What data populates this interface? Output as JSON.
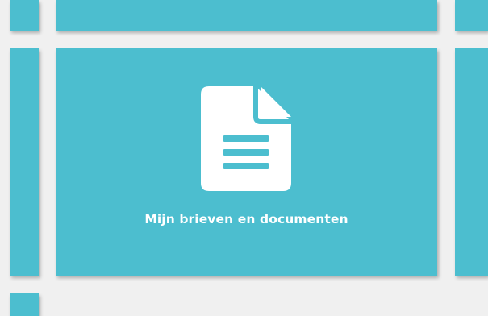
{
  "colors": {
    "background": "#f0f0f0",
    "tile": "#4cbecf",
    "icon": "#ffffff",
    "label": "#ffffff"
  },
  "main_tile": {
    "label": "Mijn brieven en documenten",
    "icon": "document-icon"
  },
  "partial_tiles": [
    {
      "name": "tile-top-left-partial"
    },
    {
      "name": "tile-top-center-partial"
    },
    {
      "name": "tile-top-right-partial"
    },
    {
      "name": "tile-left-partial"
    },
    {
      "name": "tile-right-partial"
    },
    {
      "name": "tile-bottom-left-partial"
    }
  ]
}
